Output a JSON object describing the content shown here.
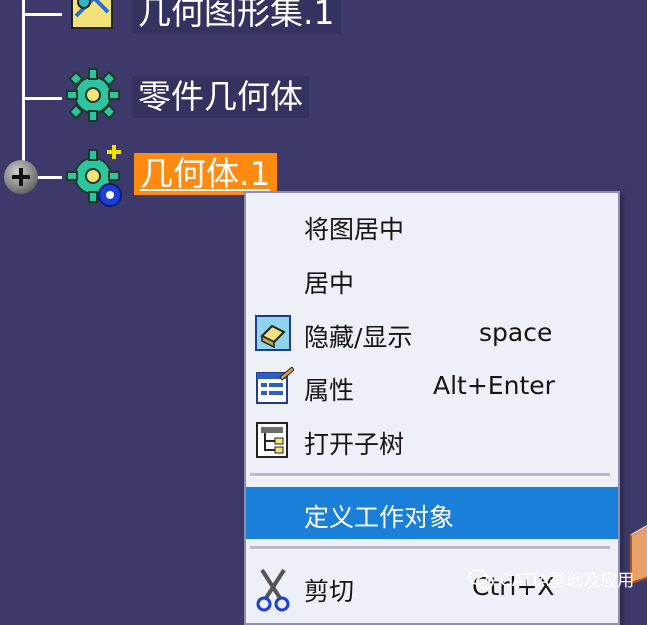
{
  "tree": {
    "nodes": [
      {
        "label": "几何图形集.1",
        "icon": "geometrical-set-icon"
      },
      {
        "label": "零件几何体",
        "icon": "part-body-gear-icon"
      },
      {
        "label": "几何体.1",
        "icon": "body-gear-icon",
        "selected": true
      }
    ],
    "expander_icon": "plus-expander-icon"
  },
  "context_menu": {
    "items": [
      {
        "label": "将图居中",
        "shortcut": ""
      },
      {
        "label": "居中",
        "shortcut": ""
      },
      {
        "label": "隐藏/显示",
        "shortcut": "space",
        "icon": "hide-show-icon"
      },
      {
        "label": "属性",
        "shortcut": "Alt+Enter",
        "icon": "properties-icon"
      },
      {
        "label": "打开子树",
        "shortcut": "",
        "icon": "open-subtree-icon"
      },
      {
        "label": "定义工作对象",
        "shortcut": "",
        "highlighted": true
      },
      {
        "label": "剪切",
        "shortcut": "Ctrl+X",
        "icon": "scissors-icon"
      }
    ]
  },
  "watermark": {
    "text": "CATIA基础及应用",
    "icon": "wechat-icon"
  },
  "colors": {
    "background": "#3d3a6b",
    "selection": "#ff8a12",
    "menu_highlight": "#1a7fd8",
    "menu_background": "#eef0f8"
  }
}
